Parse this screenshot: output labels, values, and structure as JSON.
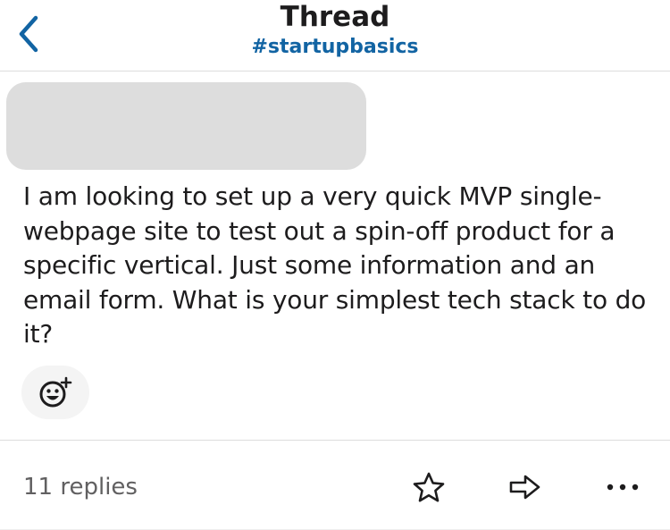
{
  "header": {
    "title": "Thread",
    "channel": "#startupbasics",
    "back_icon": "chevron-left-icon"
  },
  "message": {
    "text": "I am looking to set up a very quick MVP single-webpage site to test out a spin-off product for a specific vertical.  Just some information and an email form.  What is your simplest tech stack to do it?",
    "add_reaction_icon": "emoji-add-icon"
  },
  "footer": {
    "replies": "11 replies",
    "star_icon": "star-icon",
    "share_icon": "share-arrow-icon",
    "more_icon": "more-horizontal-icon"
  },
  "colors": {
    "accent": "#1264a3",
    "text": "#1d1c1d",
    "muted": "#616061",
    "divider": "#dddddd"
  }
}
